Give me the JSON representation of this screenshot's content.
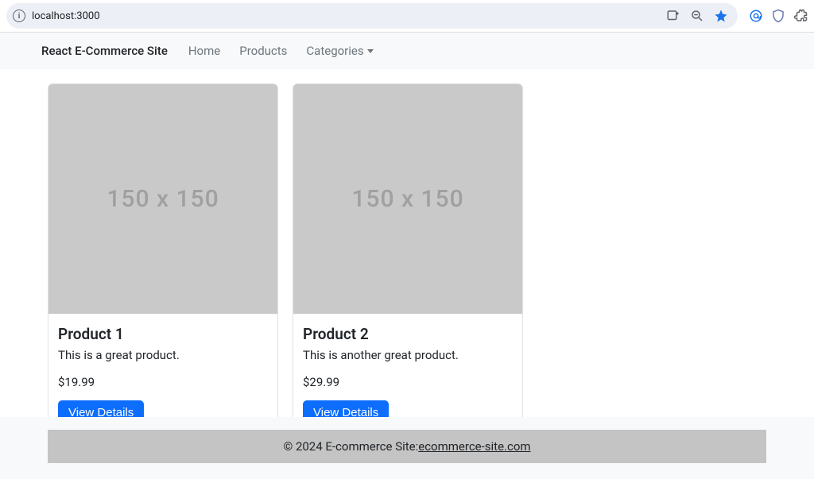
{
  "browser": {
    "url": "localhost:3000"
  },
  "navbar": {
    "brand": "React E-Commerce Site",
    "links": {
      "home": "Home",
      "products": "Products",
      "categories": "Categories"
    }
  },
  "products": [
    {
      "title": "Product 1",
      "description": "This is a great product.",
      "price": "$19.99",
      "placeholder": "150 x 150",
      "button": "View Details"
    },
    {
      "title": "Product 2",
      "description": "This is another great product.",
      "price": "$29.99",
      "placeholder": "150 x 150",
      "button": "View Details"
    }
  ],
  "footer": {
    "copyright": "© 2024 E-commerce Site:",
    "link_text": "ecommerce-site.com"
  }
}
